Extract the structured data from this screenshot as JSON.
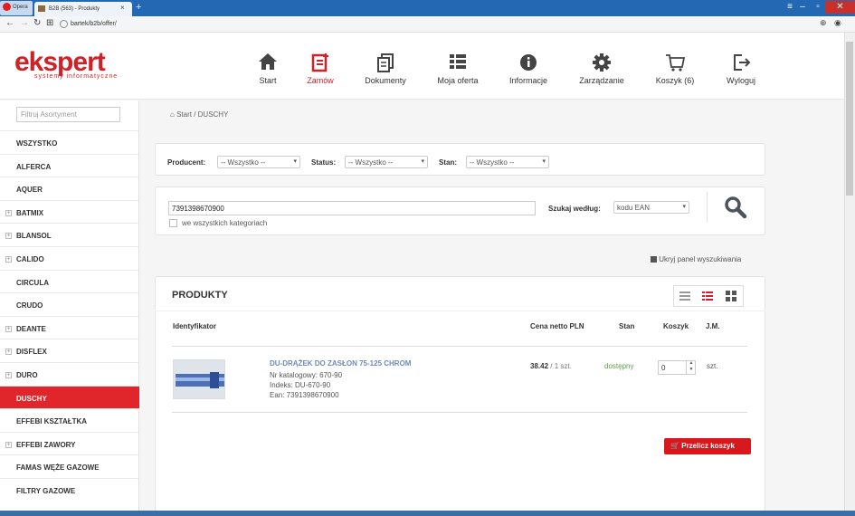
{
  "browser": {
    "app_label": "Opera",
    "tab_title": "B2B (563) - Produkty",
    "tab_close": "×",
    "new_tab": "+",
    "url": "bartek/b2b/offer/",
    "win_min": "–",
    "win_max": "▫",
    "win_close": "✕"
  },
  "logo": {
    "name": "ekspert",
    "sub": "systemy informatyczne"
  },
  "nav": [
    {
      "label": "Start",
      "icon": "home-icon"
    },
    {
      "label": "Zamów",
      "icon": "order-icon",
      "active": true
    },
    {
      "label": "Dokumenty",
      "icon": "documents-icon"
    },
    {
      "label": "Moja oferta",
      "icon": "list-icon"
    },
    {
      "label": "Informacje",
      "icon": "info-icon"
    },
    {
      "label": "Zarządzanie",
      "icon": "gear-icon"
    },
    {
      "label": "Koszyk (6)",
      "icon": "cart-icon"
    },
    {
      "label": "Wyloguj",
      "icon": "logout-icon"
    }
  ],
  "sidebar": {
    "filter_placeholder": "Filtruj Asortyment",
    "items": [
      {
        "label": "WSZYSTKO",
        "plus": false
      },
      {
        "label": "ALFERCA",
        "plus": false
      },
      {
        "label": "AQUER",
        "plus": false
      },
      {
        "label": "BATMIX",
        "plus": true
      },
      {
        "label": "BLANSOL",
        "plus": true
      },
      {
        "label": "CALIDO",
        "plus": true
      },
      {
        "label": "CIRCULA",
        "plus": false
      },
      {
        "label": "CRUDO",
        "plus": false
      },
      {
        "label": "DEANTE",
        "plus": true
      },
      {
        "label": "DISFLEX",
        "plus": true
      },
      {
        "label": "DURO",
        "plus": true
      },
      {
        "label": "DUSCHY",
        "plus": false,
        "active": true
      },
      {
        "label": "EFFEBI KSZTAŁTKA",
        "plus": false
      },
      {
        "label": "EFFEBI ZAWORY",
        "plus": true
      },
      {
        "label": "FAMAS WĘŻE GAZOWE",
        "plus": false
      },
      {
        "label": "FILTRY GAZOWE",
        "plus": false
      }
    ]
  },
  "breadcrumb": "Start / DUSCHY",
  "filters": {
    "producent_label": "Producent:",
    "status_label": "Status:",
    "stan_label": "Stan:",
    "producent_value": "-- Wszystko --",
    "status_value": "-- Wszystko --",
    "stan_value": "-- Wszystko --"
  },
  "search": {
    "value": "7391398670900",
    "all_categories": "we wszystkich kategoriach",
    "by_label": "Szukaj według:",
    "by_value": "kodu EAN",
    "hide_panel": "Ukryj panel wyszukiwania"
  },
  "products": {
    "title": "PRODUKTY",
    "headers": {
      "id": "Identyfikator",
      "price": "Cena netto PLN",
      "stan": "Stan",
      "cart": "Koszyk",
      "jm": "J.M."
    },
    "rows": [
      {
        "name": "DU-DRĄŻEK DO ZASŁON 75-125 CHROM",
        "catalog": "Nr katalogowy: 670-90",
        "index": "Indeks: DU-670-90",
        "ean": "Ean: 7391398670900",
        "price": "38.42",
        "per": "/ 1 szt.",
        "status": "dostępny",
        "qty": "0",
        "unit": "szt."
      }
    ],
    "recalc_button": "Przelicz koszyk"
  },
  "colors": {
    "brand": "#d32027",
    "link": "#6f8ab8",
    "available": "#5aa04a"
  }
}
